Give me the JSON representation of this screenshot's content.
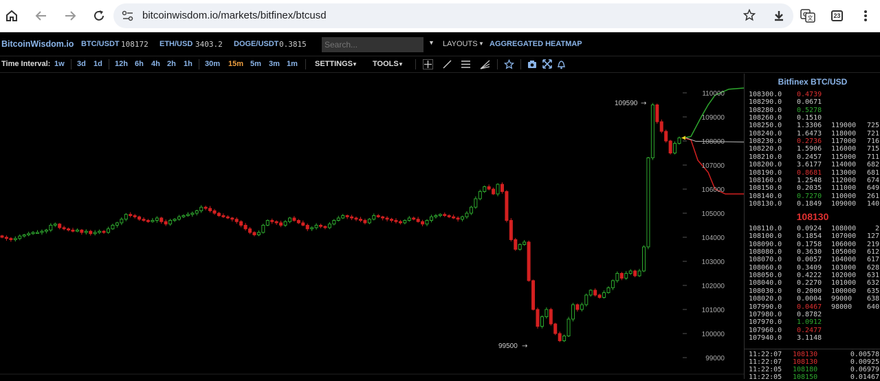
{
  "browser": {
    "url": "bitcoinwisdom.io/markets/bitfinex/btcusd",
    "tab_count": "23"
  },
  "header": {
    "logo": "BitcoinWisdom.io",
    "tickers": [
      {
        "pair": "BTC/USDT",
        "price": "108172"
      },
      {
        "pair": "ETH/USD",
        "price": "3403.2"
      },
      {
        "pair": "DOGE/USDT",
        "price": "0.3815"
      }
    ],
    "search_placeholder": "Search...",
    "layouts": "LAYOUTS",
    "heatmap": "AGGREGATED HEATMAP"
  },
  "toolbar": {
    "label": "Time Interval:",
    "intervals": [
      "1w",
      "3d",
      "1d",
      "12h",
      "6h",
      "4h",
      "2h",
      "1h",
      "30m",
      "15m",
      "5m",
      "3m",
      "1m"
    ],
    "active": "15m",
    "settings": "SETTINGS",
    "tools": "TOOLS"
  },
  "chart": {
    "y_ticks": [
      "110000",
      "109000",
      "108000",
      "107000",
      "106000",
      "105000",
      "104000",
      "103000",
      "102000",
      "101000",
      "100000",
      "99000"
    ],
    "high_marker": "109590",
    "low_marker": "99500"
  },
  "chart_data": {
    "type": "candlestick",
    "title": "",
    "y_range": [
      98800,
      110200
    ],
    "closes": [
      104000,
      103950,
      103900,
      103950,
      104050,
      104100,
      104150,
      104200,
      104200,
      104250,
      104300,
      104500,
      104550,
      104400,
      104350,
      104300,
      104250,
      104300,
      104200,
      104250,
      104150,
      104200,
      104250,
      104200,
      104350,
      104500,
      104600,
      104750,
      104950,
      104900,
      104850,
      104750,
      104700,
      104650,
      104700,
      104800,
      104650,
      104550,
      104700,
      104750,
      104850,
      104900,
      104950,
      105000,
      105100,
      105250,
      105200,
      105100,
      105000,
      104900,
      104850,
      104800,
      104750,
      104650,
      104500,
      104350,
      104200,
      104100,
      104200,
      104500,
      104700,
      104650,
      104600,
      104500,
      104650,
      104800,
      104700,
      104600,
      104500,
      104350,
      104400,
      104500,
      104450,
      104400,
      104550,
      104700,
      104800,
      104900,
      104850,
      104800,
      104750,
      104700,
      104600,
      104750,
      104900,
      104850,
      104800,
      104750,
      104700,
      104650,
      104600,
      104700,
      104800,
      104750,
      104650,
      104550,
      104700,
      104850,
      104900,
      104950,
      104900,
      104850,
      104800,
      104750,
      104850,
      105000,
      105250,
      105600,
      105900,
      106100,
      106000,
      105800,
      106200,
      105900,
      104700,
      103900,
      103500,
      103700,
      103800,
      102200,
      101000,
      100300,
      100700,
      101000,
      100400,
      100000,
      99700,
      99900,
      100600,
      101200,
      101000,
      101200,
      101600,
      101800,
      101600,
      101500,
      101700,
      101900,
      102200,
      102500,
      102300,
      102500,
      102600,
      102400,
      102600,
      103600,
      107300,
      109500,
      108800,
      108400,
      108000,
      107500,
      107900,
      108130
    ]
  },
  "orderbook": {
    "title": "Bitfinex BTC/USD",
    "last_price": "108130",
    "asks": [
      [
        "108300.0",
        "0.4739",
        "",
        ""
      ],
      [
        "108290.0",
        "0.0671",
        "",
        ""
      ],
      [
        "108280.0",
        "0.5278",
        "",
        ""
      ],
      [
        "108260.0",
        "0.1510",
        "",
        ""
      ],
      [
        "108250.0",
        "1.3306",
        "119000",
        "725"
      ],
      [
        "108240.0",
        "1.6473",
        "118000",
        "721"
      ],
      [
        "108230.0",
        "0.2736",
        "117000",
        "716"
      ],
      [
        "108220.0",
        "1.5906",
        "116000",
        "715"
      ],
      [
        "108210.0",
        "0.2457",
        "115000",
        "711"
      ],
      [
        "108200.0",
        "3.6177",
        "114000",
        "682"
      ],
      [
        "108190.0",
        "0.8681",
        "113000",
        "681"
      ],
      [
        "108160.0",
        "1.2548",
        "112000",
        "674"
      ],
      [
        "108150.0",
        "0.2035",
        "111000",
        "649"
      ],
      [
        "108140.0",
        "0.7270",
        "110000",
        "261"
      ],
      [
        "108130.0",
        "0.1849",
        "109000",
        "140"
      ]
    ],
    "bids": [
      [
        "108110.0",
        "0.0924",
        "108000",
        "2"
      ],
      [
        "108100.0",
        "0.1854",
        "107000",
        "127"
      ],
      [
        "108090.0",
        "0.1758",
        "106000",
        "219"
      ],
      [
        "108080.0",
        "0.3630",
        "105000",
        "612"
      ],
      [
        "108070.0",
        "0.0057",
        "104000",
        "617"
      ],
      [
        "108060.0",
        "0.3409",
        "103000",
        "628"
      ],
      [
        "108050.0",
        "0.4222",
        "102000",
        "631"
      ],
      [
        "108040.0",
        "0.2270",
        "101000",
        "632"
      ],
      [
        "108030.0",
        "0.2000",
        "100000",
        "635"
      ],
      [
        "108020.0",
        "0.0004",
        "99000",
        "638"
      ],
      [
        "107990.0",
        "0.0467",
        "98000",
        "640"
      ],
      [
        "107980.0",
        "0.8782",
        "",
        ""
      ],
      [
        "107970.0",
        "1.0912",
        "",
        ""
      ],
      [
        "107960.0",
        "0.2477",
        "",
        ""
      ],
      [
        "107940.0",
        "3.1148",
        "",
        ""
      ]
    ],
    "trades": [
      [
        "11:22:07",
        "108130",
        "0.00578",
        "sell"
      ],
      [
        "11:22:07",
        "108130",
        "0.00925",
        "sell"
      ],
      [
        "11:22:05",
        "108180",
        "0.06979",
        "buy"
      ],
      [
        "11:22:05",
        "108150",
        "0.01467",
        "buy"
      ]
    ]
  },
  "colors": {
    "up": "#2ea82e",
    "down": "#d32020",
    "accent": "#8ab4e8",
    "active": "#f0a040"
  }
}
